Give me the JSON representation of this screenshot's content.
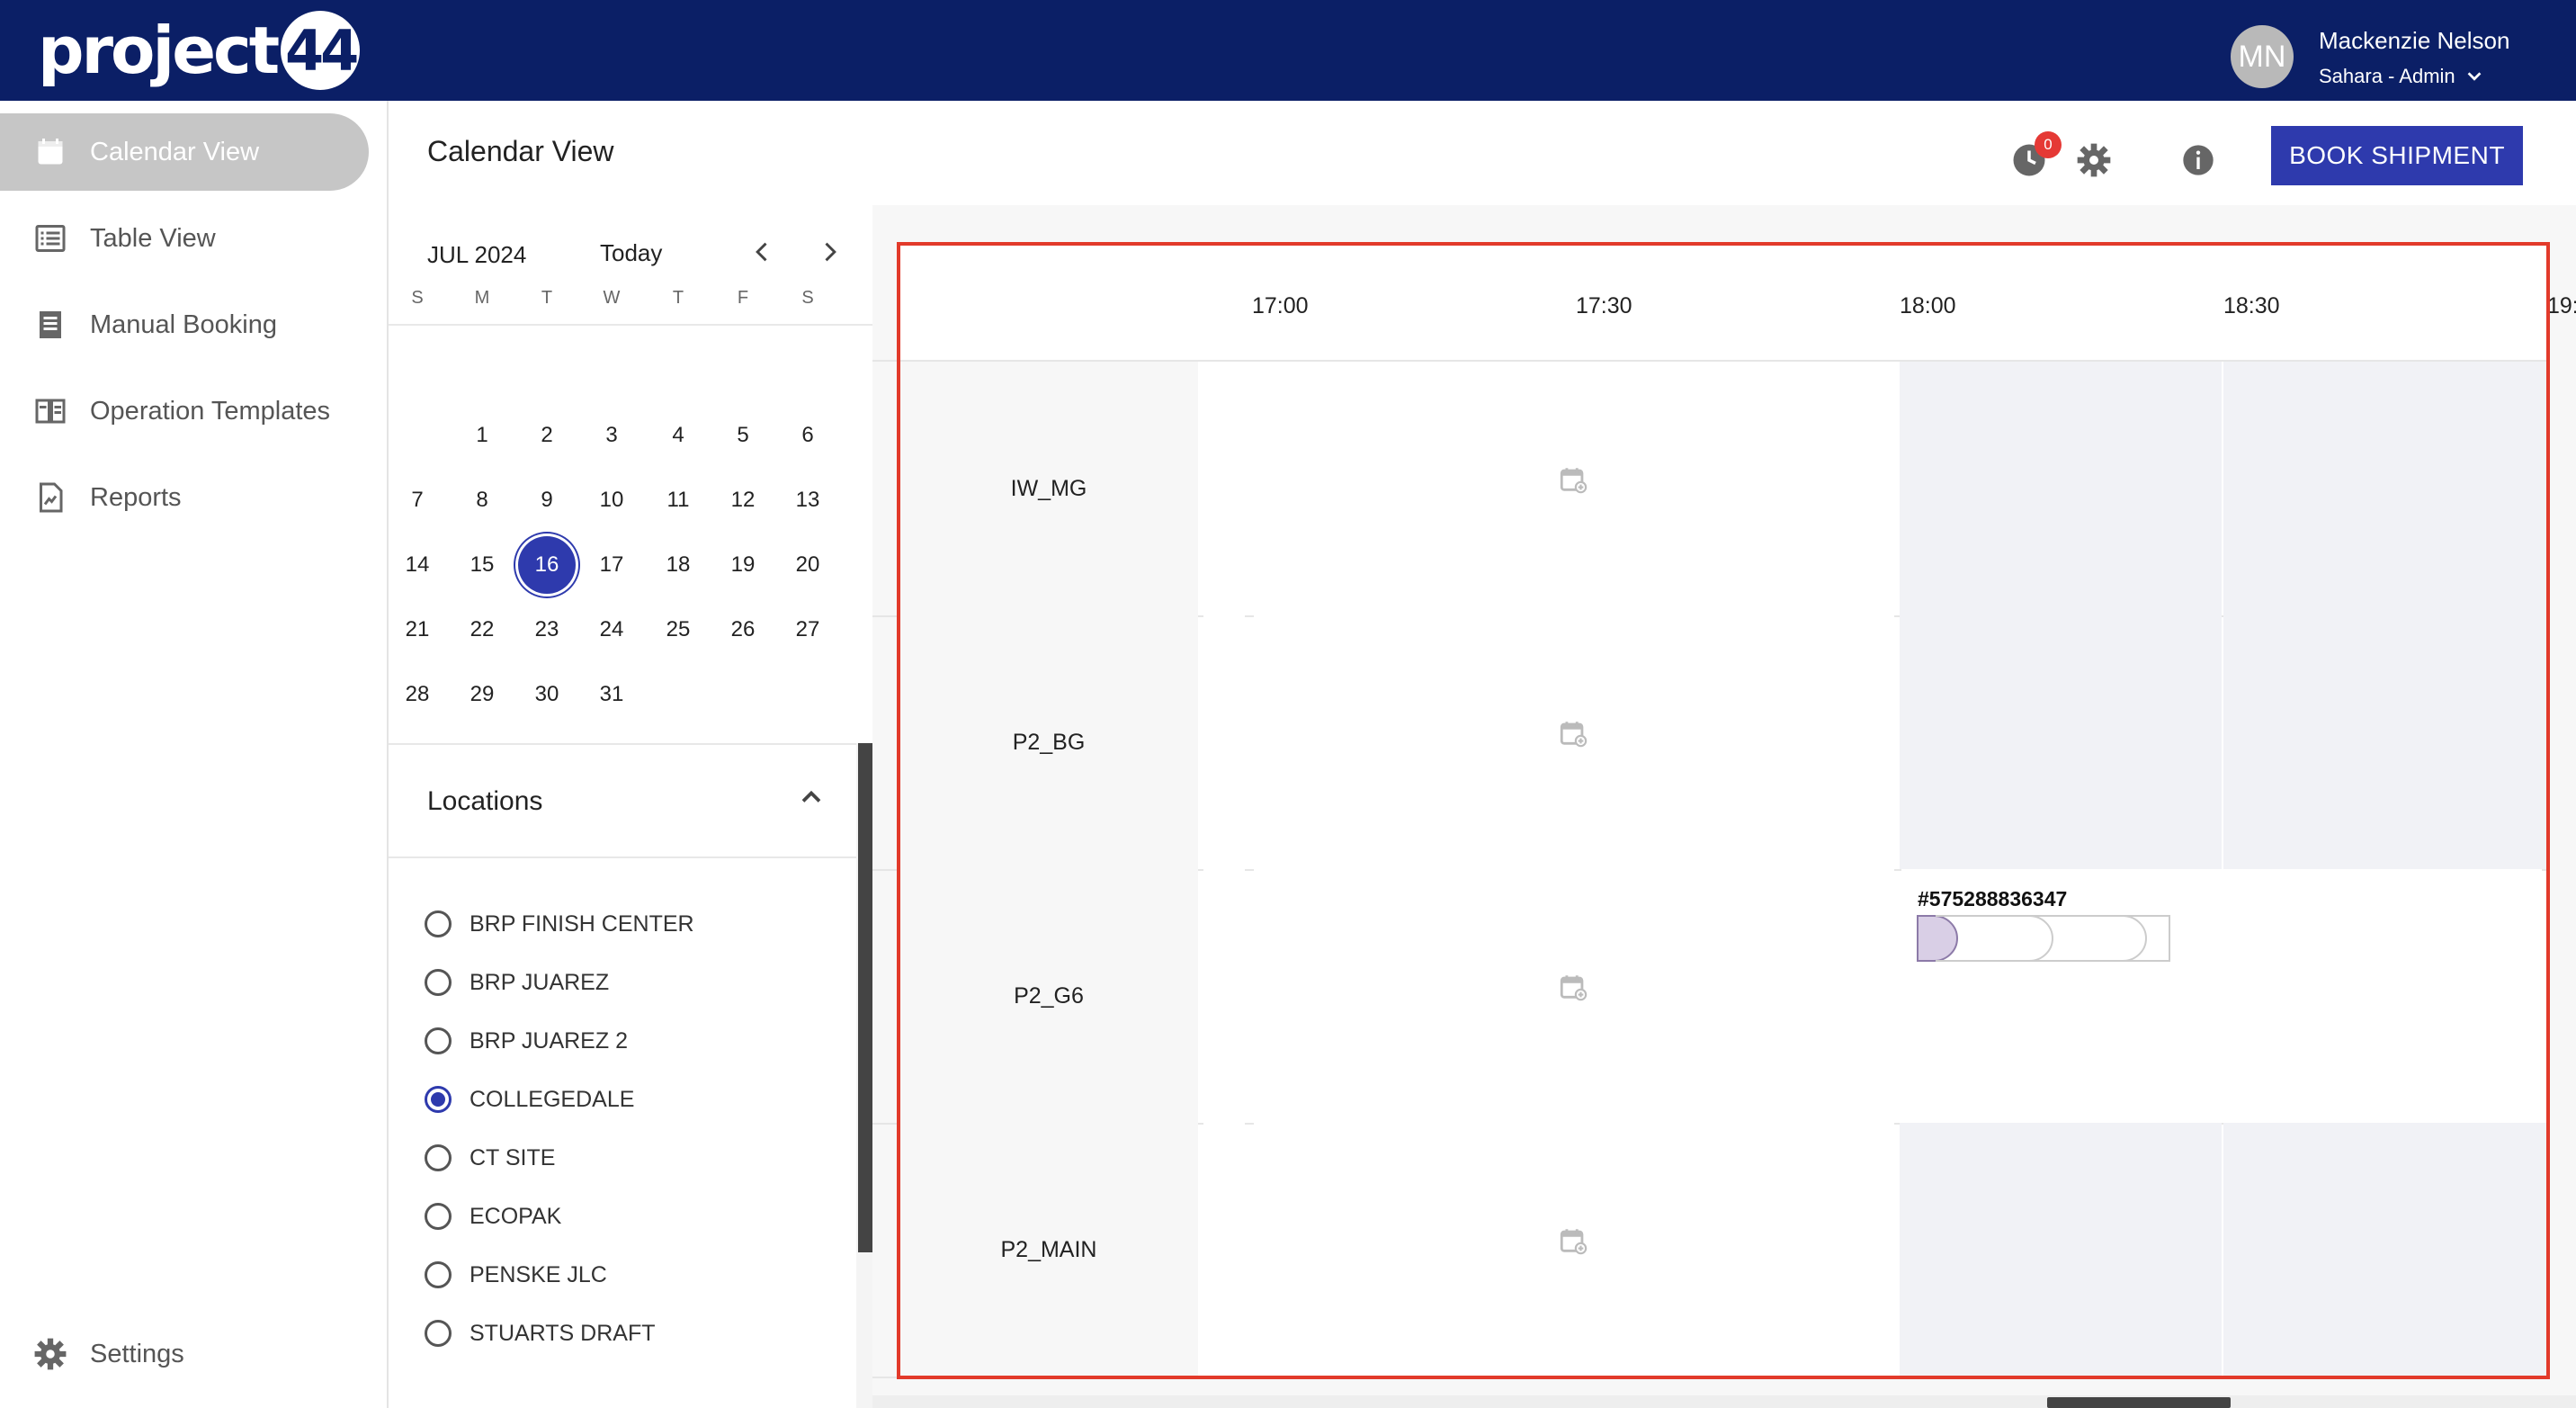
{
  "brand": {
    "logo_text": "project",
    "logo_badge": "44"
  },
  "user": {
    "initials": "MN",
    "name": "Mackenzie Nelson",
    "role": "Sahara - Admin"
  },
  "sidebar": {
    "items": [
      {
        "label": "Calendar View",
        "icon": "calendar-icon",
        "active": true
      },
      {
        "label": "Table View",
        "icon": "list-icon",
        "active": false
      },
      {
        "label": "Manual Booking",
        "icon": "receipt-icon",
        "active": false
      },
      {
        "label": "Operation Templates",
        "icon": "book-icon",
        "active": false
      },
      {
        "label": "Reports",
        "icon": "report-icon",
        "active": false
      }
    ],
    "settings_label": "Settings"
  },
  "header": {
    "title": "Calendar View",
    "notification_count": "0",
    "book_button": "BOOK SHIPMENT"
  },
  "mini_calendar": {
    "month": "JUL 2024",
    "today_label": "Today",
    "weekdays": [
      "S",
      "M",
      "T",
      "W",
      "T",
      "F",
      "S"
    ],
    "weeks": [
      [
        "",
        "1",
        "2",
        "3",
        "4",
        "5",
        "6"
      ],
      [
        "7",
        "8",
        "9",
        "10",
        "11",
        "12",
        "13"
      ],
      [
        "14",
        "15",
        "16",
        "17",
        "18",
        "19",
        "20"
      ],
      [
        "21",
        "22",
        "23",
        "24",
        "25",
        "26",
        "27"
      ],
      [
        "28",
        "29",
        "30",
        "31",
        "",
        "",
        ""
      ]
    ],
    "selected_day": "16"
  },
  "locations": {
    "title": "Locations",
    "items": [
      {
        "label": "BRP FINISH CENTER",
        "checked": false
      },
      {
        "label": "BRP JUAREZ",
        "checked": false
      },
      {
        "label": "BRP JUAREZ 2",
        "checked": false
      },
      {
        "label": "COLLEGEDALE",
        "checked": true
      },
      {
        "label": "CT SITE",
        "checked": false
      },
      {
        "label": "ECOPAK",
        "checked": false
      },
      {
        "label": "PENSKE JLC",
        "checked": false
      },
      {
        "label": "STUARTS DRAFT",
        "checked": false
      }
    ]
  },
  "schedule": {
    "times": [
      "17:00",
      "17:30",
      "18:00",
      "18:30",
      "19:"
    ],
    "docks": [
      "IW_MG",
      "P2_BG",
      "P2_G6",
      "P2_MAIN"
    ],
    "booking": {
      "dock": "P2_G6",
      "id": "#575288836347"
    }
  },
  "colors": {
    "topbar": "#0b1f66",
    "accent": "#2e3aad",
    "highlight_frame": "#e23a2a",
    "badge": "#e53935"
  }
}
